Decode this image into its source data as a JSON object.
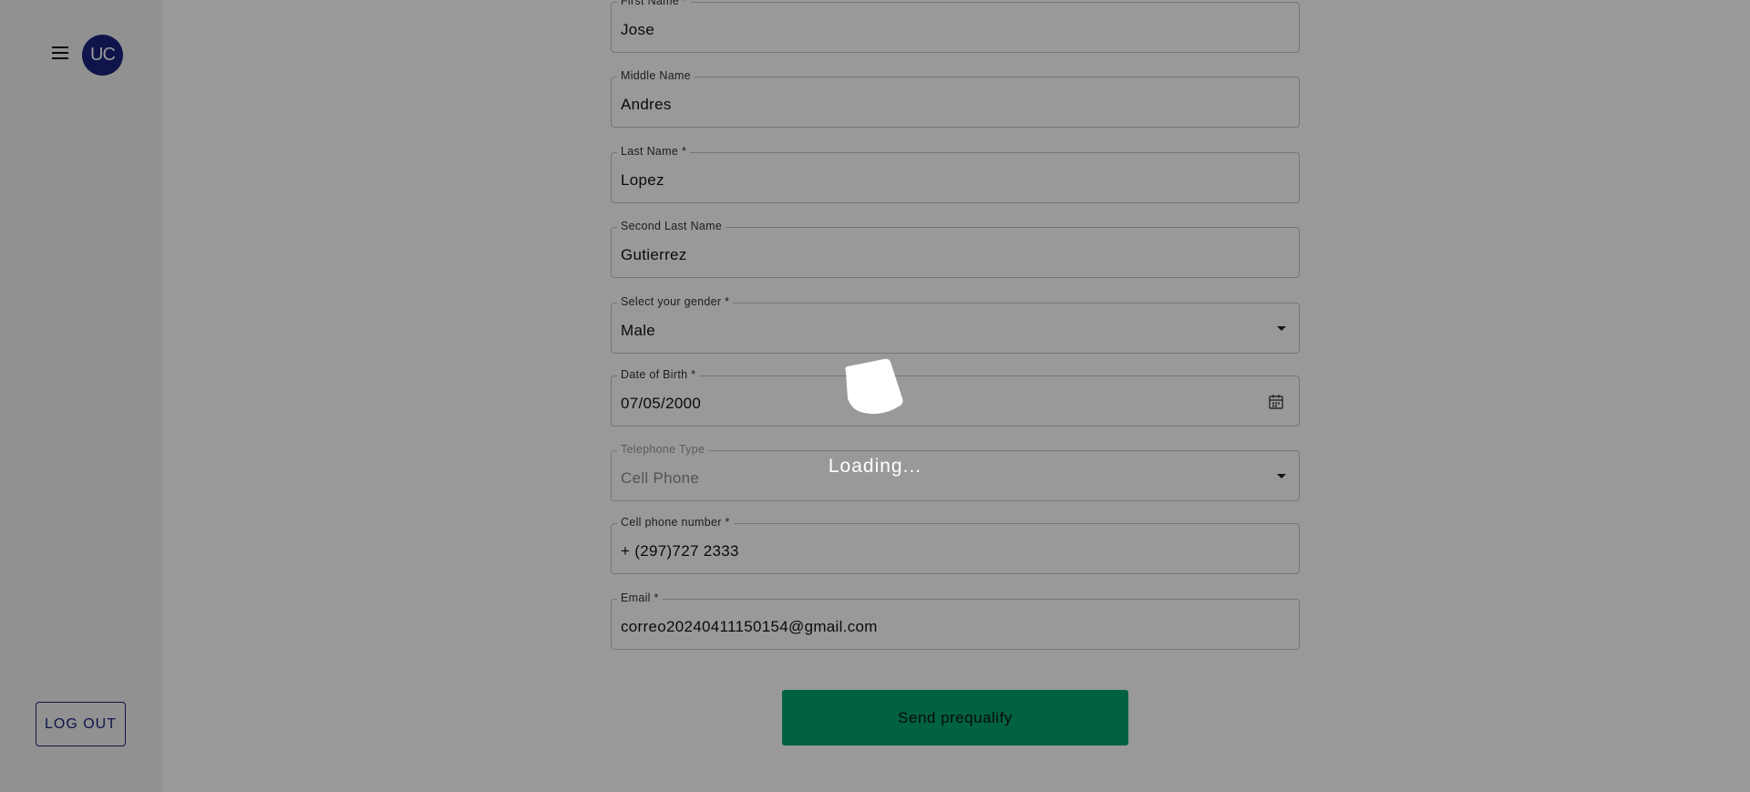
{
  "sidebar": {
    "menu_icon": "hamburger-menu-icon",
    "avatar_initials": "UC",
    "logout_label": "LOG OUT"
  },
  "form": {
    "first_name": {
      "label": "First Name *",
      "value": "Jose"
    },
    "middle_name": {
      "label": "Middle Name",
      "value": "Andres"
    },
    "last_name": {
      "label": "Last Name *",
      "value": "Lopez"
    },
    "second_last_name": {
      "label": "Second Last Name",
      "value": "Gutierrez"
    },
    "gender": {
      "label": "Select your gender *",
      "value": "Male"
    },
    "dob": {
      "label": "Date of Birth *",
      "value": "07/05/2000"
    },
    "phone_type": {
      "label": "Telephone Type",
      "value": "Cell Phone"
    },
    "cell_phone": {
      "label": "Cell phone number *",
      "value": "+ (297)727 2333"
    },
    "email": {
      "label": "Email *",
      "value": "correo20240411150154@gmail.com"
    },
    "submit_label": "Send prequalify"
  },
  "overlay": {
    "loading_text": "Loading..."
  },
  "colors": {
    "accent": "#1a237e",
    "submit": "#00a36c"
  }
}
